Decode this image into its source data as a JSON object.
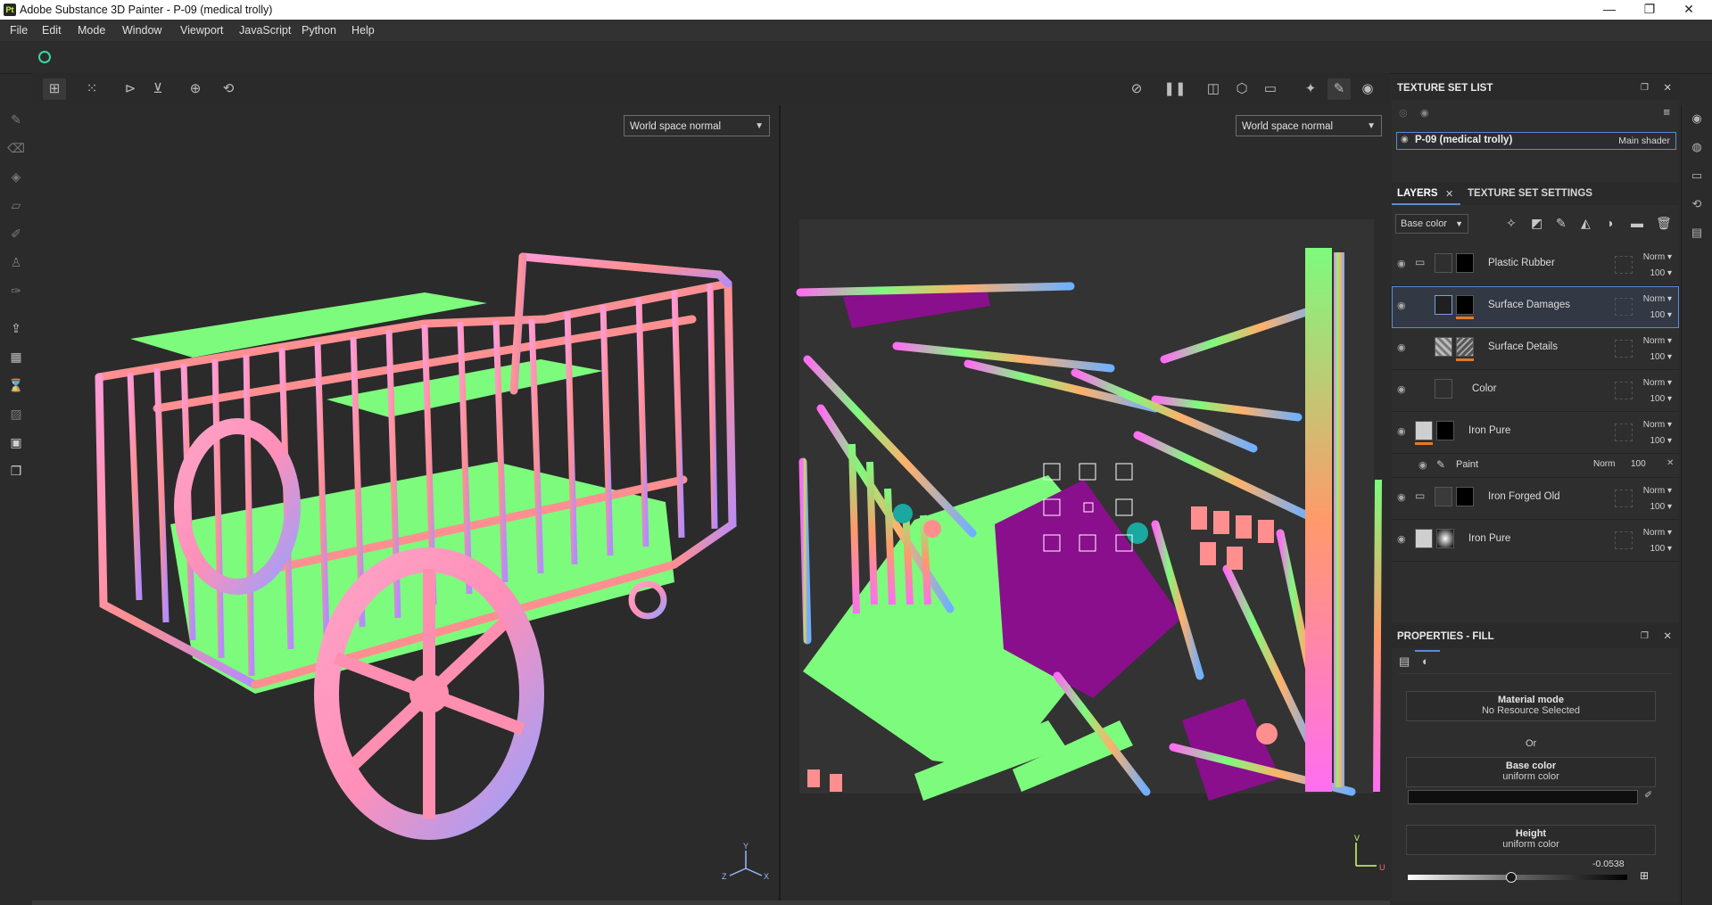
{
  "window": {
    "app_icon": "Pt",
    "title": "Adobe Substance 3D Painter - P-09 (medical trolly)",
    "controls": {
      "minimize": "—",
      "maximize": "❐",
      "close": "✕"
    }
  },
  "menu": [
    "File",
    "Edit",
    "Mode",
    "Window",
    "Viewport",
    "JavaScript",
    "Python",
    "Help"
  ],
  "viewports": {
    "left_mode": "World space normal",
    "right_mode": "World space normal",
    "gizmo_3d": {
      "y": "Y",
      "x": "X",
      "z": "Z"
    },
    "gizmo_2d": {
      "v": "V",
      "u": "U"
    }
  },
  "texture_set_list": {
    "title": "TEXTURE SET LIST",
    "item_name": "P-09 (medical trolly)",
    "item_shader": "Main shader"
  },
  "layers_panel": {
    "tabs": [
      "LAYERS",
      "TEXTURE SET SETTINGS"
    ],
    "channel": "Base color",
    "layers": [
      {
        "name": "Plastic Rubber",
        "blend": "Norm",
        "opacity": "100",
        "folder": true
      },
      {
        "name": "Surface Damages",
        "blend": "Norm",
        "opacity": "100",
        "selected": true
      },
      {
        "name": "Surface Details",
        "blend": "Norm",
        "opacity": "100"
      },
      {
        "name": "Color",
        "blend": "Norm",
        "opacity": "100"
      },
      {
        "name": "Iron Pure",
        "blend": "Norm",
        "opacity": "100"
      },
      {
        "name": "Iron Forged Old",
        "blend": "Norm",
        "opacity": "100",
        "folder": true
      },
      {
        "name": "Iron Pure",
        "blend": "Norm",
        "opacity": "100"
      }
    ],
    "sub_effect": {
      "name": "Paint",
      "blend": "Norm",
      "opacity": "100"
    }
  },
  "properties": {
    "title": "PROPERTIES - FILL",
    "material_mode_label": "Material mode",
    "material_mode_value": "No Resource Selected",
    "or_label": "Or",
    "base_color_label": "Base color",
    "base_color_value": "uniform color",
    "height_label": "Height",
    "height_value": "uniform color",
    "height_number": "-0.0538",
    "height_slider_fraction": 0.47
  },
  "colors": {
    "accent": "#5d8ad8",
    "panel": "#2e2e2e",
    "normal_green": "#7dfb7d",
    "normal_purple": "#8a0f8c"
  }
}
